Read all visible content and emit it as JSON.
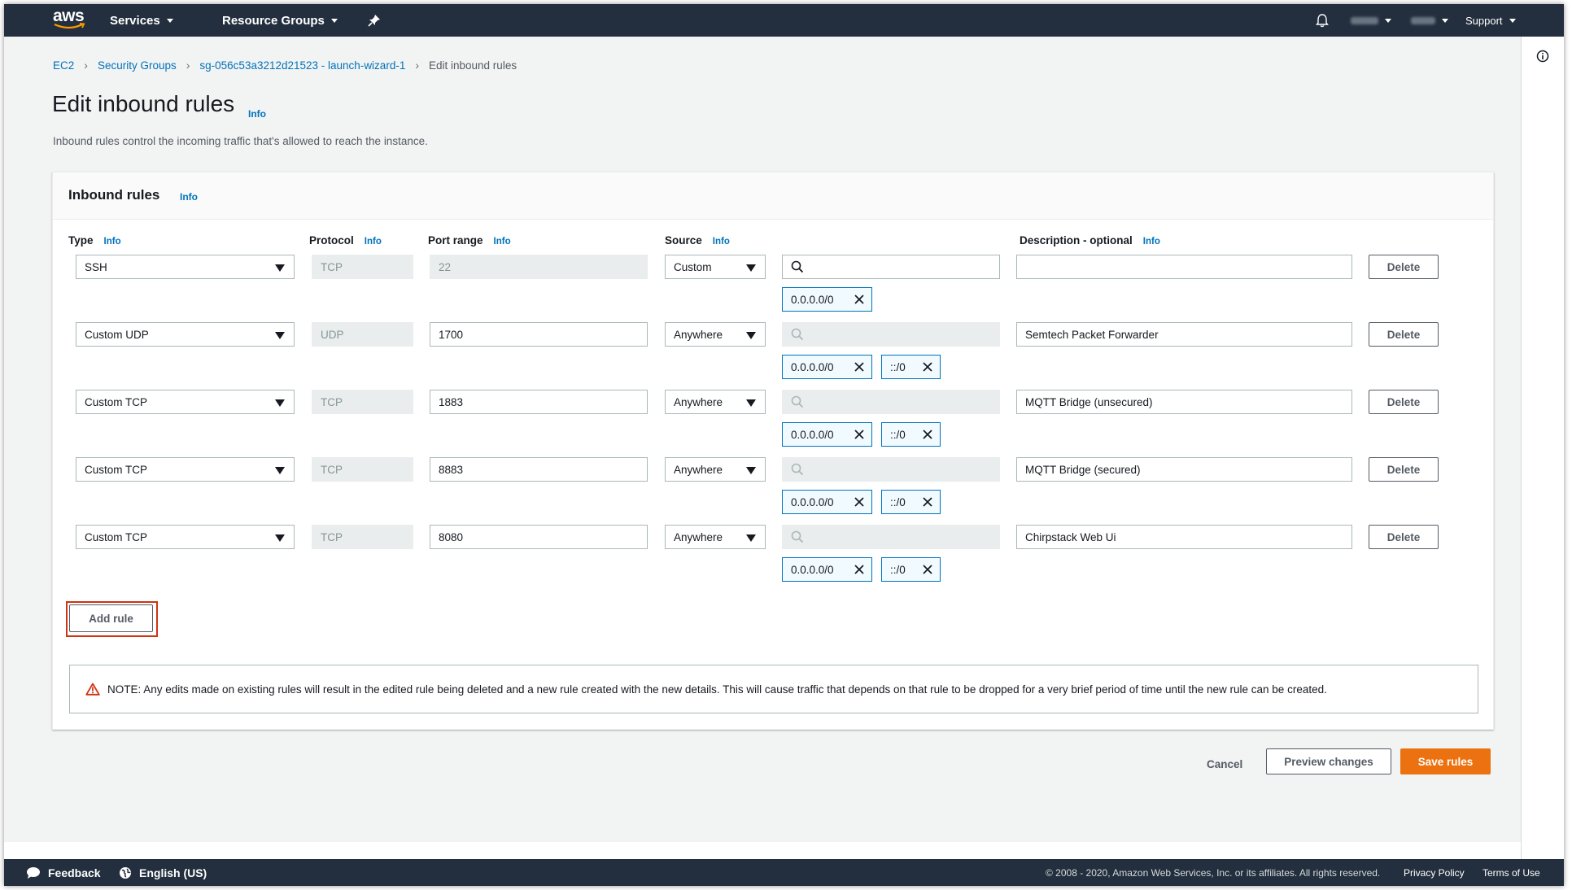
{
  "nav": {
    "logo": "aws",
    "services": "Services",
    "resource_groups": "Resource Groups",
    "support": "Support"
  },
  "breadcrumb": [
    {
      "label": "EC2"
    },
    {
      "label": "Security Groups"
    },
    {
      "label": "sg-056c53a3212d21523 - launch-wizard-1"
    },
    {
      "label": "Edit inbound rules"
    }
  ],
  "page": {
    "title": "Edit inbound rules",
    "title_info": "Info",
    "description": "Inbound rules control the incoming traffic that's allowed to reach the instance."
  },
  "panel": {
    "title": "Inbound rules",
    "info": "Info",
    "columns": {
      "type": "Type",
      "protocol": "Protocol",
      "port_range": "Port range",
      "source": "Source",
      "description": "Description - optional",
      "info": "Info"
    },
    "rules": [
      {
        "type": "SSH",
        "protocol": "TCP",
        "port": "22",
        "source": "Custom",
        "tags": [
          "0.0.0.0/0"
        ],
        "description": "",
        "delete": "Delete"
      },
      {
        "type": "Custom UDP",
        "protocol": "UDP",
        "port": "1700",
        "source": "Anywhere",
        "tags": [
          "0.0.0.0/0",
          "::/0"
        ],
        "description": "Semtech Packet Forwarder",
        "delete": "Delete"
      },
      {
        "type": "Custom TCP",
        "protocol": "TCP",
        "port": "1883",
        "source": "Anywhere",
        "tags": [
          "0.0.0.0/0",
          "::/0"
        ],
        "description": "MQTT Bridge (unsecured)",
        "delete": "Delete"
      },
      {
        "type": "Custom TCP",
        "protocol": "TCP",
        "port": "8883",
        "source": "Anywhere",
        "tags": [
          "0.0.0.0/0",
          "::/0"
        ],
        "description": "MQTT Bridge (secured)",
        "delete": "Delete"
      },
      {
        "type": "Custom TCP",
        "protocol": "TCP",
        "port": "8080",
        "source": "Anywhere",
        "tags": [
          "0.0.0.0/0",
          "::/0"
        ],
        "description": "Chirpstack Web Ui",
        "delete": "Delete"
      }
    ],
    "add_rule": "Add rule",
    "note": "NOTE: Any edits made on existing rules will result in the edited rule being deleted and a new rule created with the new details. This will cause traffic that depends on that rule to be dropped for a very brief period of time until the new rule can be created."
  },
  "actions": {
    "cancel": "Cancel",
    "preview": "Preview changes",
    "save": "Save rules"
  },
  "footer": {
    "feedback": "Feedback",
    "language": "English (US)",
    "copyright": "© 2008 - 2020, Amazon Web Services, Inc. or its affiliates. All rights reserved.",
    "privacy": "Privacy Policy",
    "terms": "Terms of Use"
  },
  "colors": {
    "nav_bg": "#232f3e",
    "link": "#0073bb",
    "primary": "#ec7211",
    "highlight": "#d13212"
  }
}
